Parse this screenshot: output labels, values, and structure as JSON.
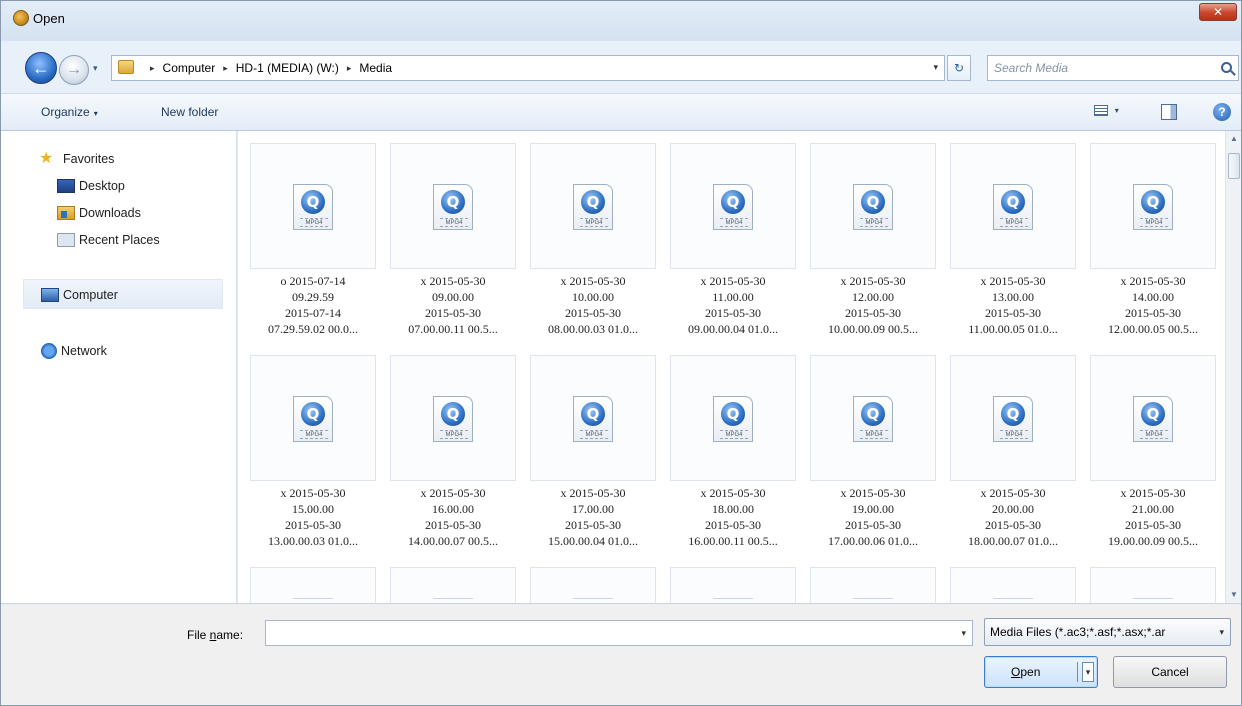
{
  "window": {
    "title": "Open",
    "close_glyph": "✕"
  },
  "nav": {
    "back_glyph": "←",
    "forward_glyph": "→",
    "breadcrumbs": [
      "Computer",
      "HD-1 (MEDIA) (W:)",
      "Media"
    ],
    "separator_glyph": "▸",
    "dropdown_glyph": "▾",
    "refresh_glyph": "↻",
    "search_placeholder": "Search Media"
  },
  "toolbar": {
    "organize_label": "Organize",
    "new_folder_label": "New folder",
    "help_glyph": "?"
  },
  "sidebar": {
    "favorites_label": "Favorites",
    "favorites_items": [
      {
        "label": "Desktop",
        "icon": "desktop-icon"
      },
      {
        "label": "Downloads",
        "icon": "downloads-icon"
      },
      {
        "label": "Recent Places",
        "icon": "recent-places-icon"
      }
    ],
    "computer_label": "Computer",
    "network_label": "Network"
  },
  "files": [
    {
      "name": "o 2015-07-14",
      "line2": "09.29.59",
      "line3": "2015-07-14",
      "line4": "07.29.59.02 00.0..."
    },
    {
      "name": "x 2015-05-30",
      "line2": "09.00.00",
      "line3": "2015-05-30",
      "line4": "07.00.00.11 00.5..."
    },
    {
      "name": "x 2015-05-30",
      "line2": "10.00.00",
      "line3": "2015-05-30",
      "line4": "08.00.00.03 01.0..."
    },
    {
      "name": "x 2015-05-30",
      "line2": "11.00.00",
      "line3": "2015-05-30",
      "line4": "09.00.00.04 01.0..."
    },
    {
      "name": "x 2015-05-30",
      "line2": "12.00.00",
      "line3": "2015-05-30",
      "line4": "10.00.00.09 00.5..."
    },
    {
      "name": "x 2015-05-30",
      "line2": "13.00.00",
      "line3": "2015-05-30",
      "line4": "11.00.00.05 01.0..."
    },
    {
      "name": "x 2015-05-30",
      "line2": "14.00.00",
      "line3": "2015-05-30",
      "line4": "12.00.00.05 00.5..."
    },
    {
      "name": "x 2015-05-30",
      "line2": "15.00.00",
      "line3": "2015-05-30",
      "line4": "13.00.00.03 01.0..."
    },
    {
      "name": "x 2015-05-30",
      "line2": "16.00.00",
      "line3": "2015-05-30",
      "line4": "14.00.00.07 00.5..."
    },
    {
      "name": "x 2015-05-30",
      "line2": "17.00.00",
      "line3": "2015-05-30",
      "line4": "15.00.00.04 01.0..."
    },
    {
      "name": "x 2015-05-30",
      "line2": "18.00.00",
      "line3": "2015-05-30",
      "line4": "16.00.00.11 00.5..."
    },
    {
      "name": "x 2015-05-30",
      "line2": "19.00.00",
      "line3": "2015-05-30",
      "line4": "17.00.00.06 01.0..."
    },
    {
      "name": "x 2015-05-30",
      "line2": "20.00.00",
      "line3": "2015-05-30",
      "line4": "18.00.00.07 01.0..."
    },
    {
      "name": "x 2015-05-30",
      "line2": "21.00.00",
      "line3": "2015-05-30",
      "line4": "19.00.00.09 00.5..."
    }
  ],
  "file_icon": {
    "badge": "MPG4",
    "glyph": "Q",
    "icon": "mpeg4-video-icon"
  },
  "bottom": {
    "filename_label_prefix": "File ",
    "filename_label_underlined": "n",
    "filename_label_suffix": "ame:",
    "filename_value": "",
    "filter_value": "Media Files (*.ac3;*.asf;*.asx;*.ar",
    "open_label": "Open",
    "cancel_label": "Cancel"
  },
  "colors": {
    "window_frame": "#dfe9f5",
    "toolbar_text": "#1e395b",
    "selection_blue": "#3b7bd0",
    "close_red": "#c9452c"
  }
}
